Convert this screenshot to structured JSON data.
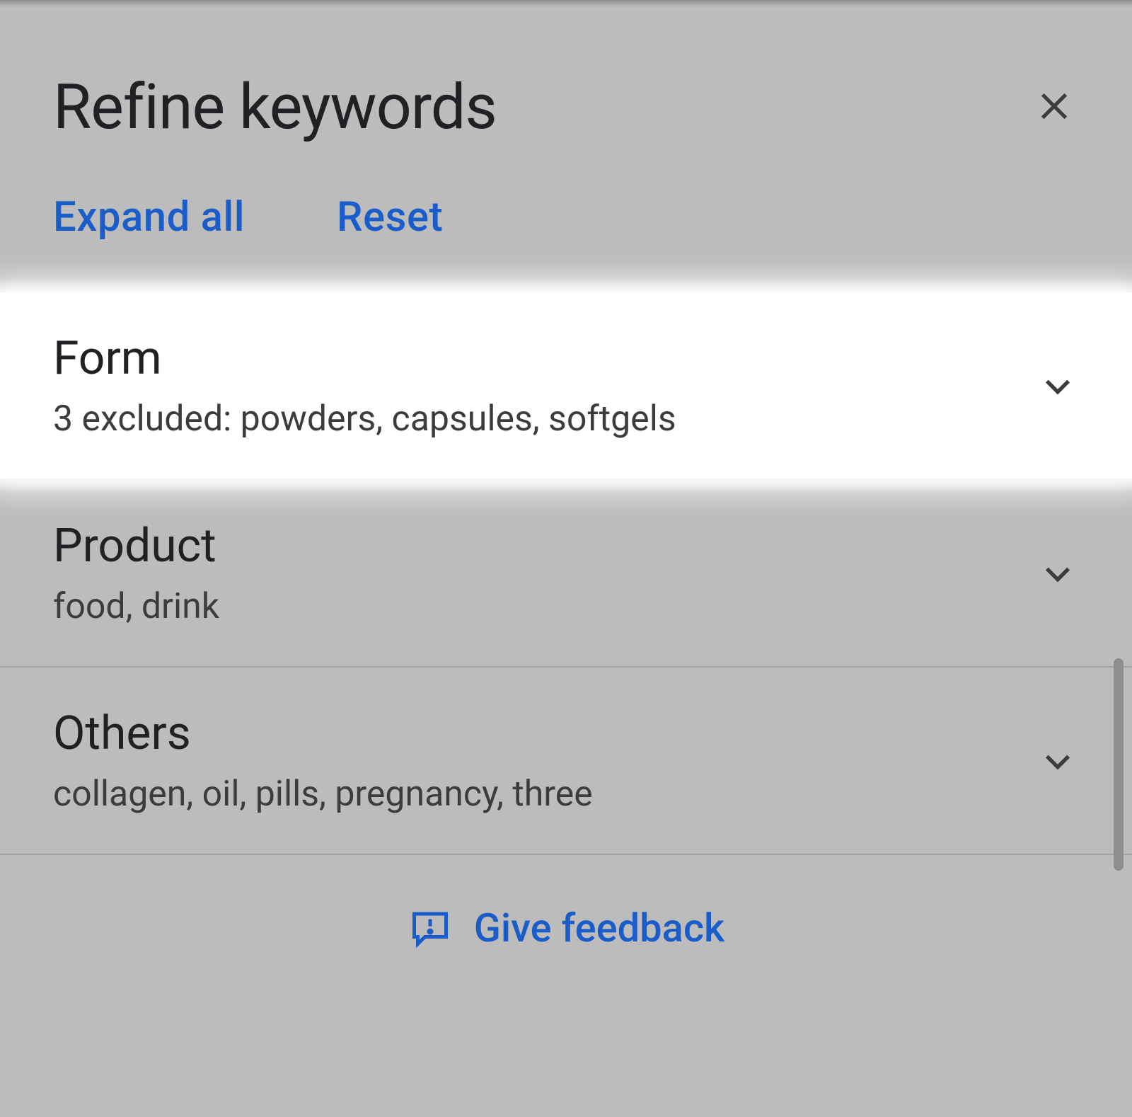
{
  "panel": {
    "title": "Refine keywords",
    "actions": {
      "expand_all": "Expand all",
      "reset": "Reset"
    }
  },
  "categories": [
    {
      "title": "Form",
      "subtitle": "3 excluded: powders, capsules, softgels",
      "highlighted": true
    },
    {
      "title": "Product",
      "subtitle": "food, drink",
      "highlighted": false
    },
    {
      "title": "Others",
      "subtitle": "collagen, oil, pills, pregnancy, three",
      "highlighted": false
    }
  ],
  "feedback": {
    "label": "Give feedback"
  }
}
